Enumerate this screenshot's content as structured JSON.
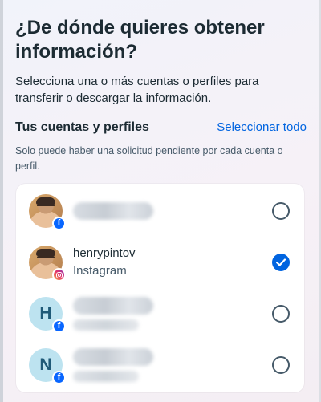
{
  "header": {
    "title": "¿De dónde quieres obtener información?",
    "description": "Selecciona una o más cuentas o perfiles para transferir o descargar la información."
  },
  "accounts_section": {
    "title": "Tus cuentas y perfiles",
    "select_all_label": "Seleccionar todo",
    "note": "Solo puede haber una solicitud pendiente por cada cuenta o perfil."
  },
  "accounts": [
    {
      "avatar": "photo",
      "platform_icon": "facebook-icon",
      "name": "",
      "type": "",
      "selected": false
    },
    {
      "avatar": "photo",
      "platform_icon": "instagram-icon",
      "name": "henrypintov",
      "type": "Instagram",
      "selected": true
    },
    {
      "avatar": "H",
      "platform_icon": "facebook-icon",
      "name": "",
      "type": "",
      "selected": false
    },
    {
      "avatar": "N",
      "platform_icon": "facebook-icon",
      "name": "",
      "type": "",
      "selected": false
    }
  ],
  "colors": {
    "accent": "#0064e0",
    "facebook": "#0866ff",
    "text_primary": "#1c2b33",
    "text_secondary": "#465a69",
    "letter_avatar_bg": "#bde3f0"
  }
}
